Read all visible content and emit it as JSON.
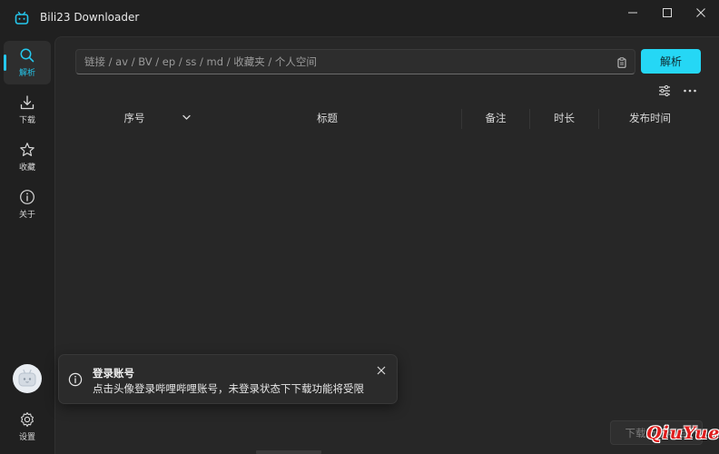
{
  "app": {
    "title": "Bili23 Downloader"
  },
  "sidebar": {
    "items": [
      {
        "label": "解析",
        "icon": "search-icon",
        "active": true
      },
      {
        "label": "下载",
        "icon": "download-icon",
        "active": false
      },
      {
        "label": "收藏",
        "icon": "star-icon",
        "active": false
      },
      {
        "label": "关于",
        "icon": "info-icon",
        "active": false
      }
    ],
    "settings_label": "设置"
  },
  "search": {
    "placeholder": "链接 / av / BV / ep / ss / md / 收藏夹 / 个人空间",
    "value": "",
    "button_label": "解析"
  },
  "table": {
    "columns": [
      "序号",
      "标题",
      "备注",
      "时长",
      "发布时间"
    ],
    "rows": []
  },
  "toast": {
    "title": "登录账号",
    "message": "点击头像登录哔哩哔哩账号，未登录状态下下载功能将受限"
  },
  "footer": {
    "download_button_label": "下载所选项目"
  },
  "watermark": "QiuYue",
  "colors": {
    "accent": "#25d7f5",
    "background": "#202020",
    "panel": "#272727"
  }
}
